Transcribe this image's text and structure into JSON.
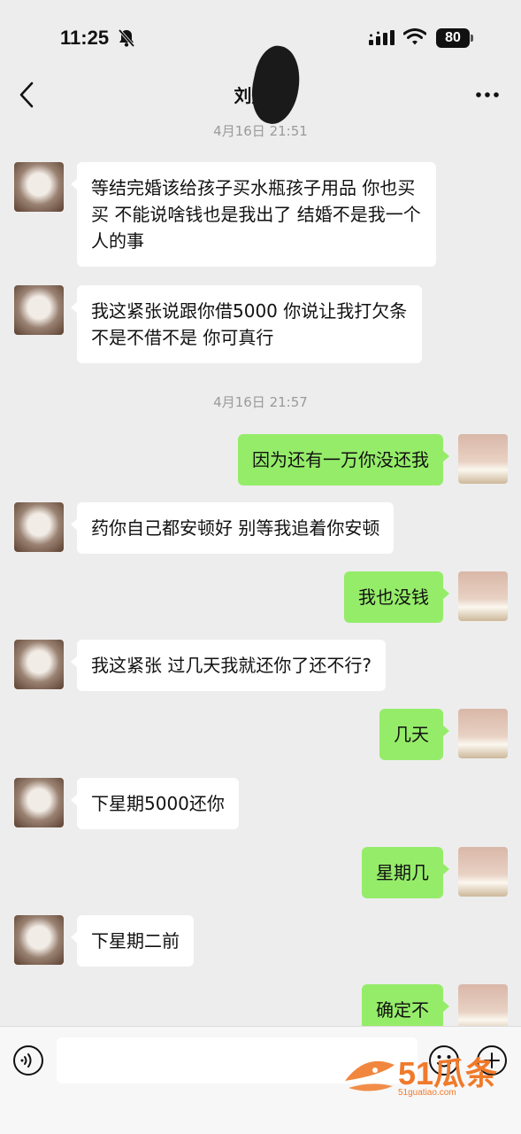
{
  "status_bar": {
    "time": "11:25",
    "battery": "80"
  },
  "header": {
    "title": "刘航汝"
  },
  "timestamps": [
    "4月16日 21:51",
    "4月16日 21:57"
  ],
  "messages": [
    {
      "side": "in",
      "text": "等结完婚该给孩子买水瓶孩子用品 你也买买 不能说啥钱也是我出了 结婚不是我一个人的事"
    },
    {
      "side": "in",
      "text": "我这紧张说跟你借5000 你说让我打欠条不是不借不是 你可真行"
    },
    {
      "side": "out",
      "text": "因为还有一万你没还我"
    },
    {
      "side": "in",
      "text": "药你自己都安顿好 别等我追着你安顿"
    },
    {
      "side": "out",
      "text": "我也没钱"
    },
    {
      "side": "in",
      "text": "我这紧张 过几天我就还你了还不行?"
    },
    {
      "side": "out",
      "text": "几天"
    },
    {
      "side": "in",
      "text": "下星期5000还你"
    },
    {
      "side": "out",
      "text": "星期几"
    },
    {
      "side": "in",
      "text": "下星期二前"
    },
    {
      "side": "out",
      "text": "确定不"
    }
  ],
  "input": {
    "placeholder": ""
  },
  "icons": {
    "back": "chevron-left-icon",
    "more": "more-dots-icon",
    "voice": "voice-icon",
    "emoji": "emoji-icon",
    "plus": "plus-icon"
  },
  "colors": {
    "outgoing_bubble": "#95ec69",
    "incoming_bubble": "#ffffff",
    "background": "#ededed",
    "watermark": "#f07a2a"
  },
  "watermark": {
    "brand": "51瓜条",
    "url": "51guatiao.com"
  }
}
